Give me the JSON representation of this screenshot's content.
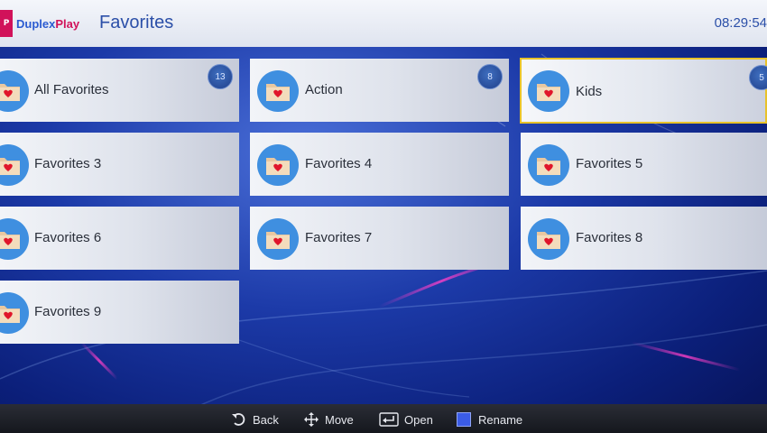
{
  "header": {
    "logo_mark": "P",
    "logo_part1": "Duplex",
    "logo_part2": "Play",
    "title": "Favorites",
    "clock": "08:29:54"
  },
  "tiles": [
    {
      "label": "All Favorites",
      "badge": "13"
    },
    {
      "label": "Action",
      "badge": "8"
    },
    {
      "label": "Kids",
      "badge": "5",
      "selected": true
    },
    {
      "label": "Favorites 3"
    },
    {
      "label": "Favorites 4"
    },
    {
      "label": "Favorites 5"
    },
    {
      "label": "Favorites 6"
    },
    {
      "label": "Favorites 7"
    },
    {
      "label": "Favorites 8"
    },
    {
      "label": "Favorites 9"
    }
  ],
  "footer": {
    "back": "Back",
    "move": "Move",
    "open": "Open",
    "rename": "Rename"
  },
  "colors": {
    "brand_pink": "#d1125a",
    "brand_blue": "#2b5bd1",
    "selection": "#e8c22a",
    "folder_circle": "#3f8fe0",
    "rename_key": "#3b5ce6"
  },
  "icons": {
    "tile": "heart-folder-icon",
    "back": "back-arrow-icon",
    "move": "dpad-icon",
    "open": "enter-icon",
    "rename": "blue-key-icon"
  }
}
